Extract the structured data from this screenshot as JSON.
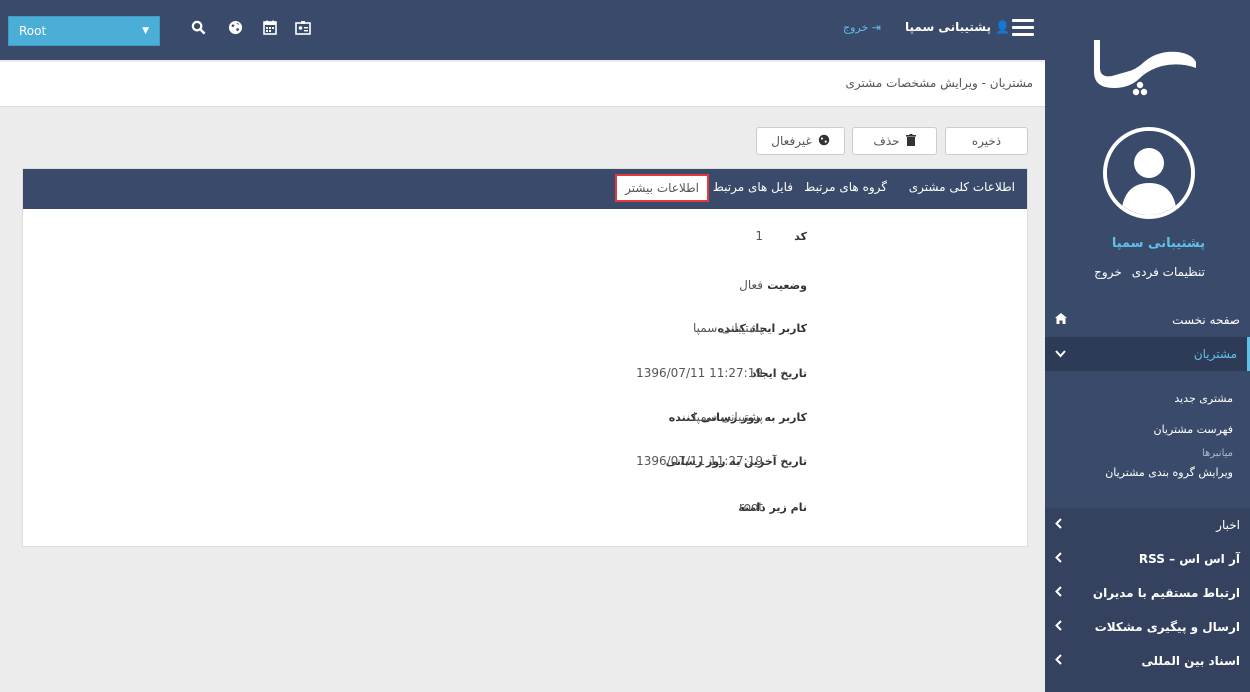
{
  "topbar": {
    "root_select": "Root",
    "user_name": "پشتیبانی سمپا",
    "logout": "خروج"
  },
  "breadcrumb": "مشتریان - ویرایش مشخصات مشتری",
  "actions": {
    "save": "ذخیره",
    "delete": "حذف",
    "deactivate": "غیرفعال"
  },
  "tabs": [
    {
      "label": "اطلاعات کلی مشتری"
    },
    {
      "label": "گروه های مرتبط"
    },
    {
      "label": "فایل های مرتبط"
    },
    {
      "label": "اطلاعات بیشتر"
    }
  ],
  "fields": [
    {
      "label": "کد",
      "value": "1"
    },
    {
      "label": "وضعیت",
      "value": "فعال"
    },
    {
      "label": "کاربر ایجاد کننده",
      "value": "پشتیبانی سمپا"
    },
    {
      "label": "تاریخ ایجاد",
      "value": "11:27:19 1396/07/11"
    },
    {
      "label": "کاربر به روز رسانی کننده",
      "value": "پشتیبانی سمپا"
    },
    {
      "label": "تاریخ آخرین به روز رسانی",
      "value": "11:27:19 1396/07/11"
    },
    {
      "label": "نام زیر دامنه",
      "value": "root"
    }
  ],
  "sidebar": {
    "user_name": "پشتیبانی سمپا",
    "settings": "تنظیمات فردی",
    "logout": "خروج",
    "home": "صفحه نخست",
    "customers": "مشتریان",
    "sub_items": [
      {
        "label": "مشتری جدید"
      },
      {
        "label": "فهرست مشتریان"
      },
      {
        "label": "میانبرها"
      },
      {
        "label": "ویرایش گروه بندی مشتریان"
      }
    ],
    "groups": [
      {
        "label": "اخبار"
      },
      {
        "label": "آر اس اس – RSS"
      },
      {
        "label": "ارتباط مستقیم با مدیران"
      },
      {
        "label": "ارسال و پیگیری مشکلات"
      },
      {
        "label": "اسناد بین المللی"
      }
    ]
  },
  "colors": {
    "navy": "#3a4a6b",
    "accent": "#5fc0ea",
    "select": "#4aaed6",
    "highlight": "#e03a3a"
  }
}
